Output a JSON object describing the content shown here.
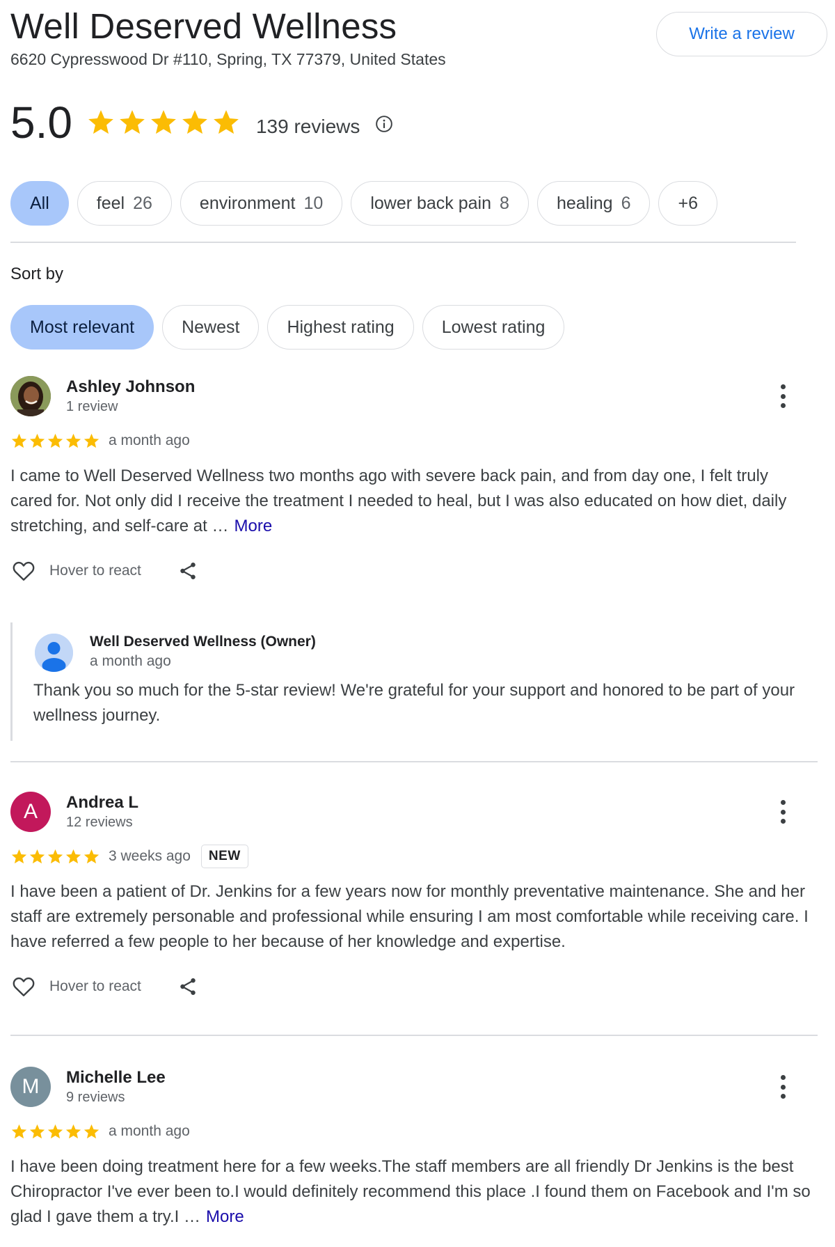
{
  "business": {
    "name": "Well Deserved Wellness",
    "address": "6620 Cypresswood Dr #110, Spring, TX 77379, United States",
    "write_review_label": "Write a review",
    "rating": "5.0",
    "rating_value": 5,
    "review_count_label": "139 reviews"
  },
  "colors": {
    "star": "#fbbc04",
    "active_chip": "#a8c7fa",
    "link": "#1a73e8",
    "more_link": "#1a0dab",
    "avatar_andrea": "#c2185b",
    "avatar_michelle": "#78909c"
  },
  "topic_chips": [
    {
      "label": "All",
      "count": ""
    },
    {
      "label": "feel",
      "count": "26"
    },
    {
      "label": "environment",
      "count": "10"
    },
    {
      "label": "lower back pain",
      "count": "8"
    },
    {
      "label": "healing",
      "count": "6"
    },
    {
      "label": "+6",
      "count": ""
    }
  ],
  "sort": {
    "label": "Sort by",
    "options": [
      "Most relevant",
      "Newest",
      "Highest rating",
      "Lowest rating"
    ],
    "selected": "Most relevant"
  },
  "reviews": [
    {
      "name": "Ashley Johnson",
      "sub": "1 review",
      "stars": 5,
      "time": "a month ago",
      "text": "I came to Well Deserved Wellness two months ago with severe back pain, and from day one, I felt truly cared for. Not only did I receive the treatment I needed to heal, but I was also educated on how diet, daily stretching, and self-care at …",
      "more": "More",
      "react": "Hover to react",
      "avatar_icon": "profile-photo"
    },
    {
      "name": "Andrea L",
      "sub": "12 reviews",
      "stars": 5,
      "time": "3 weeks ago",
      "badge": "NEW",
      "initial": "A",
      "text": "I have been a patient of Dr. Jenkins for a few years now for monthly preventative maintenance. She and her staff are extremely personable and professional while ensuring I am most comfortable while receiving care. I have referred a few people to her because of her knowledge and expertise.",
      "react": "Hover to react"
    },
    {
      "name": "Michelle Lee",
      "sub": "9 reviews",
      "stars": 5,
      "time": "a month ago",
      "initial": "M",
      "text": "I have been doing treatment here for a few weeks.The staff members are all friendly Dr Jenkins is the best Chiropractor I've ever been to.I would definitely recommend this place .I found them on Facebook and I'm so glad I gave them a try.I …",
      "more": "More"
    }
  ],
  "owner_reply": {
    "name": "Well Deserved Wellness (Owner)",
    "time": "a month ago",
    "text": "Thank you so much for the 5-star review! We're grateful for your support and honored to be part of your wellness journey."
  },
  "icons": {
    "info": "info-icon",
    "heart": "heart-icon",
    "share": "share-icon",
    "more_options": "more-vert-icon",
    "star": "star-icon"
  }
}
